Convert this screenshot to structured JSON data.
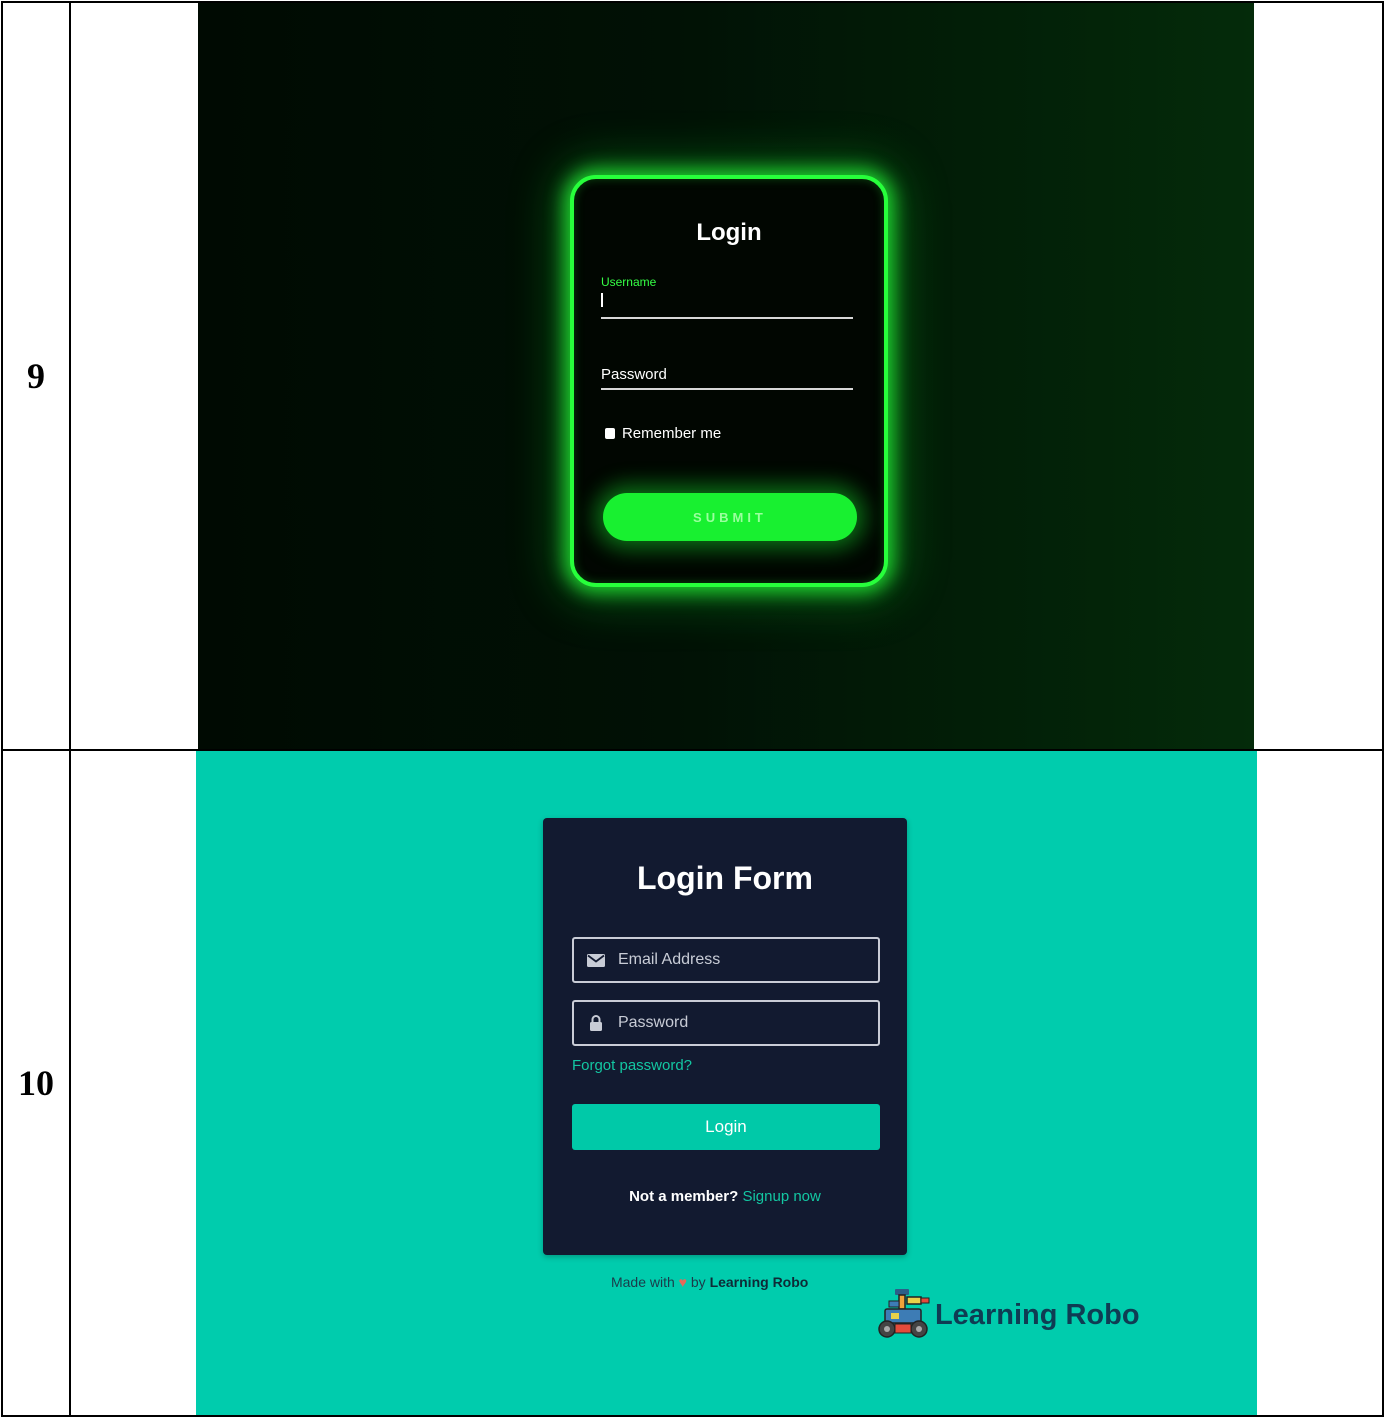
{
  "rows": [
    {
      "number": "9",
      "screenshot": {
        "title": "Login",
        "username_label": "Username",
        "password_label": "Password",
        "remember_label": "Remember me",
        "submit_label": "SUBMIT",
        "accent_color": "#27ff3b",
        "background_color": "#000a02"
      }
    },
    {
      "number": "10",
      "screenshot": {
        "title": "Login Form",
        "email_placeholder": "Email Address",
        "password_placeholder": "Password",
        "forgot_label": "Forgot password?",
        "login_label": "Login",
        "not_member_text": "Not a member?",
        "signup_label": "Signup now",
        "made_with_prefix": "Made with",
        "made_with_heart": "♥",
        "made_with_by": "by",
        "made_with_brand": "Learning Robo",
        "logo_text": "Learning Robo",
        "accent_color": "#00ccad",
        "card_color": "#121a30",
        "email_icon": "envelope-icon",
        "password_icon": "lock-icon",
        "logo_icon": "robot-icon"
      }
    }
  ]
}
